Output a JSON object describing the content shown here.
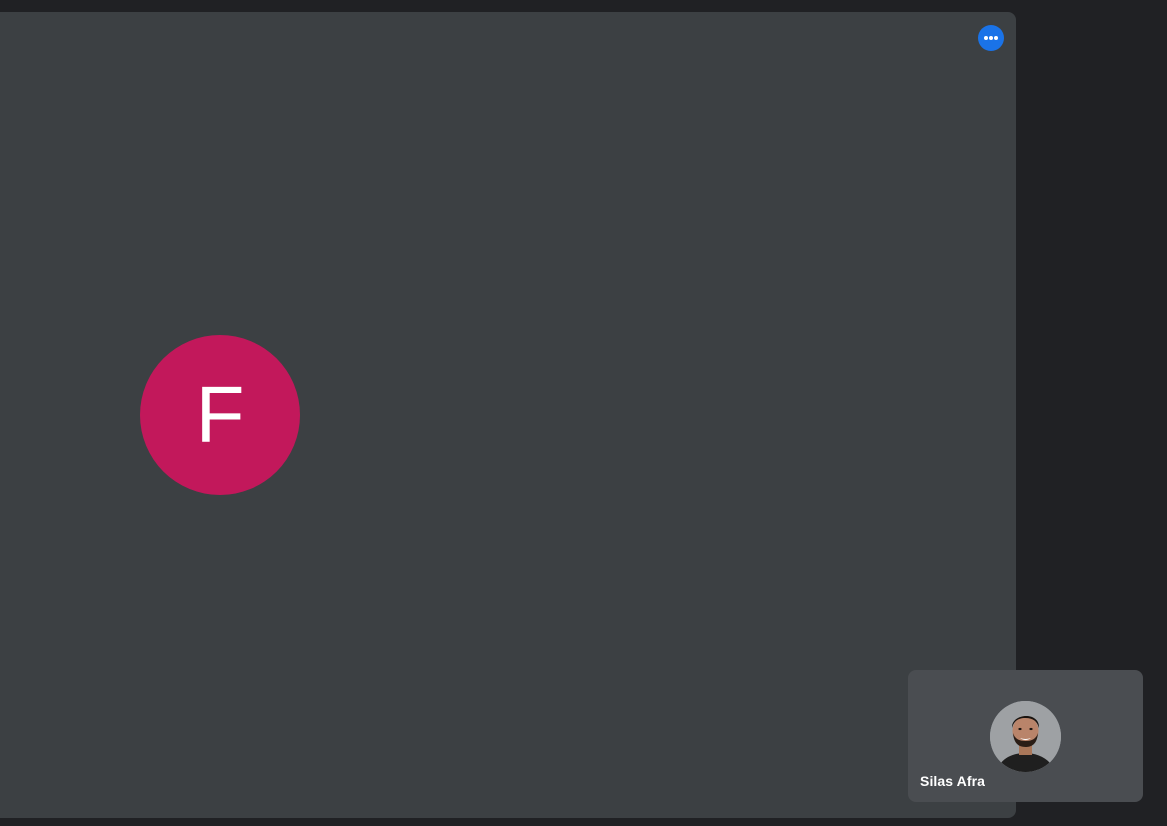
{
  "meeting": {
    "main_tile": {
      "avatar_initial": "F",
      "avatar_color": "#c2185b",
      "more_options_icon": "more-horizontal-icon"
    },
    "self_view": {
      "name": "Silas Afra",
      "avatar_icon": "profile-photo"
    }
  },
  "colors": {
    "background": "#202124",
    "tile": "#3c4043",
    "self_tile": "#4a4d51",
    "accent": "#1a73e8"
  }
}
